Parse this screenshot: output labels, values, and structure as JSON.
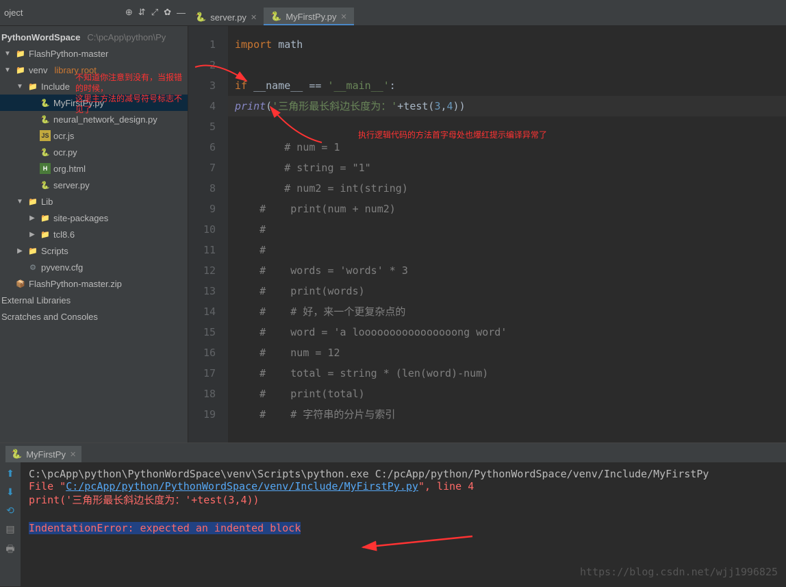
{
  "toolbar": {
    "project_label": "oject"
  },
  "tabs": [
    {
      "label": "server.py",
      "active": false
    },
    {
      "label": "MyFirstPy.py",
      "active": true
    }
  ],
  "tree": {
    "root_name": "PythonWordSpace",
    "root_path": "C:\\pcApp\\python\\Py",
    "items": [
      {
        "depth": 0,
        "arrow": "down",
        "icon": "folder",
        "label": "FlashPython-master"
      },
      {
        "depth": 0,
        "arrow": "down",
        "icon": "folder",
        "label": "venv",
        "suffix": "library root"
      },
      {
        "depth": 1,
        "arrow": "down",
        "icon": "folder",
        "label": "Include"
      },
      {
        "depth": 2,
        "arrow": "",
        "icon": "py",
        "label": "MyFirstPy.py",
        "selected": true
      },
      {
        "depth": 2,
        "arrow": "",
        "icon": "py",
        "label": "neural_network_design.py"
      },
      {
        "depth": 2,
        "arrow": "",
        "icon": "js",
        "label": "ocr.js"
      },
      {
        "depth": 2,
        "arrow": "",
        "icon": "py",
        "label": "ocr.py"
      },
      {
        "depth": 2,
        "arrow": "",
        "icon": "html",
        "label": "org.html"
      },
      {
        "depth": 2,
        "arrow": "",
        "icon": "py",
        "label": "server.py"
      },
      {
        "depth": 1,
        "arrow": "down",
        "icon": "folder",
        "label": "Lib"
      },
      {
        "depth": 2,
        "arrow": "right",
        "icon": "folder",
        "label": "site-packages"
      },
      {
        "depth": 2,
        "arrow": "right",
        "icon": "folder",
        "label": "tcl8.6"
      },
      {
        "depth": 1,
        "arrow": "right",
        "icon": "folder",
        "label": "Scripts"
      },
      {
        "depth": 1,
        "arrow": "",
        "icon": "cfg",
        "label": "pyvenv.cfg"
      },
      {
        "depth": 0,
        "arrow": "",
        "icon": "zip",
        "label": "FlashPython-master.zip"
      }
    ],
    "ext_lib": "External Libraries",
    "scratches": "Scratches and Consoles"
  },
  "editor": {
    "lines": [
      {
        "n": 1,
        "raw": "import math",
        "tokens": [
          [
            "kw",
            "import "
          ],
          [
            "",
            "math"
          ]
        ]
      },
      {
        "n": 2,
        "raw": ""
      },
      {
        "n": 3,
        "raw": "if __name__ == '__main__':",
        "tokens": [
          [
            "kw",
            "if "
          ],
          [
            "",
            "__name__ == "
          ],
          [
            "str",
            "'__main__'"
          ],
          [
            "",
            ":"
          ]
        ]
      },
      {
        "n": 4,
        "hl": true,
        "raw": "print('三角形最长斜边长度为：'+test(3,4))",
        "tokens": [
          [
            "err-builtin",
            "print"
          ],
          [
            "",
            "("
          ],
          [
            "str",
            "'三角形最长斜边长度为：'"
          ],
          [
            "",
            "+test("
          ],
          [
            "num",
            "3"
          ],
          [
            "",
            ","
          ],
          [
            "num",
            "4"
          ],
          [
            "",
            ")) "
          ]
        ]
      },
      {
        "n": 5,
        "raw": ""
      },
      {
        "n": 6,
        "raw": "    # num = 1"
      },
      {
        "n": 7,
        "raw": "    # string = \"1\""
      },
      {
        "n": 8,
        "raw": "    # num2 = int(string)"
      },
      {
        "n": 9,
        "raw": "#    print(num + num2)"
      },
      {
        "n": 10,
        "raw": "#"
      },
      {
        "n": 11,
        "raw": "#"
      },
      {
        "n": 12,
        "raw": "#    words = 'words' * 3"
      },
      {
        "n": 13,
        "raw": "#    print(words)"
      },
      {
        "n": 14,
        "raw": "#    # 好，来一个更复杂点的"
      },
      {
        "n": 15,
        "raw": "#    word = 'a loooooooooooooooong word'"
      },
      {
        "n": 16,
        "raw": "#    num = 12"
      },
      {
        "n": 17,
        "raw": "#    total = string * (len(word)-num)"
      },
      {
        "n": 18,
        "raw": "#    print(total)"
      },
      {
        "n": 19,
        "raw": "#    # 字符串的分片与索引"
      }
    ]
  },
  "annotations": {
    "tree_note_l1": "不知道你注意到没有，当报错的时候，",
    "tree_note_l2": "这里主方法的减号符号标志不见了",
    "editor_note": "执行逻辑代码的方法首字母处也爆红提示编译异常了"
  },
  "run": {
    "tab": "MyFirstPy",
    "cmd": "C:\\pcApp\\python\\PythonWordSpace\\venv\\Scripts\\python.exe C:/pcApp/python/PythonWordSpace/venv/Include/MyFirstPy",
    "file_prefix": "  File ",
    "file_quote": "\"",
    "file_link": "C:/pcApp/python/PythonWordSpace/venv/Include/MyFirstPy.py",
    "file_suffix": "\", line 4",
    "code_echo": "    print('三角形最长斜边长度为：'+test(3,4))",
    "error": "IndentationError: expected an indented block"
  },
  "watermark": "https://blog.csdn.net/wjj1996825"
}
